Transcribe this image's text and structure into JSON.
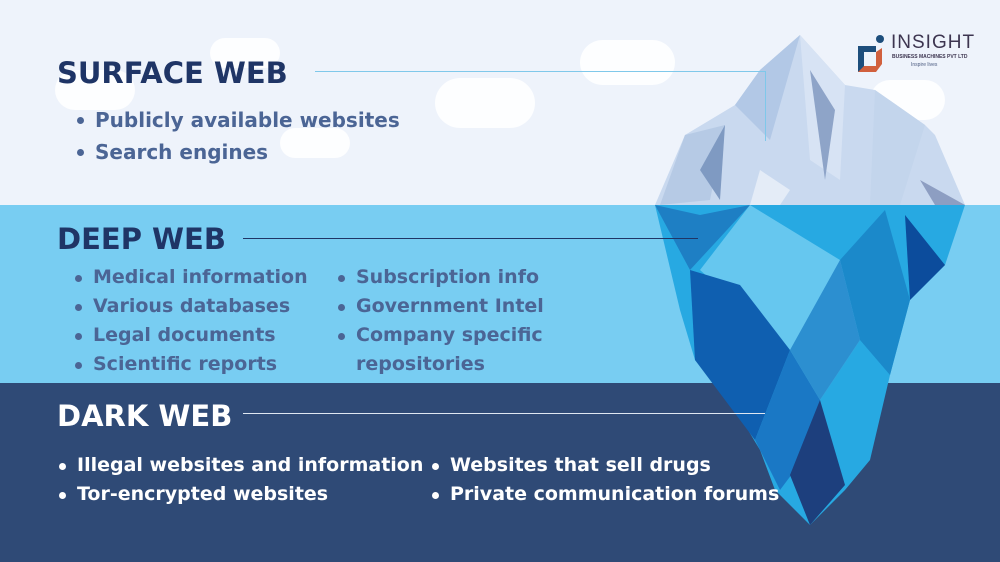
{
  "logo": {
    "title": "INSIGHT",
    "subtitle": "BUSINESS MACHINES PVT LTD",
    "tagline": "Inspire lives"
  },
  "sections": {
    "surface": {
      "title": "SURFACE WEB",
      "items": [
        "Publicly available websites",
        "Search engines"
      ]
    },
    "deep": {
      "title": "DEEP WEB",
      "col1": [
        "Medical information",
        "Various databases",
        "Legal documents",
        "Scientific reports"
      ],
      "col2": [
        "Subscription info",
        "Government Intel",
        "Company specific",
        "repositories"
      ]
    },
    "dark": {
      "title": "DARK WEB",
      "col1": [
        "Illegal websites and information",
        "Tor-encrypted websites"
      ],
      "col2": [
        "Websites that sell drugs",
        "Private communication forums"
      ]
    }
  },
  "colors": {
    "surface_bg": "#eef3fb",
    "deep_bg": "#78cdf2",
    "dark_bg": "#2f4a76",
    "heading_navy": "#1f3566",
    "body_text": "#4b6595"
  }
}
